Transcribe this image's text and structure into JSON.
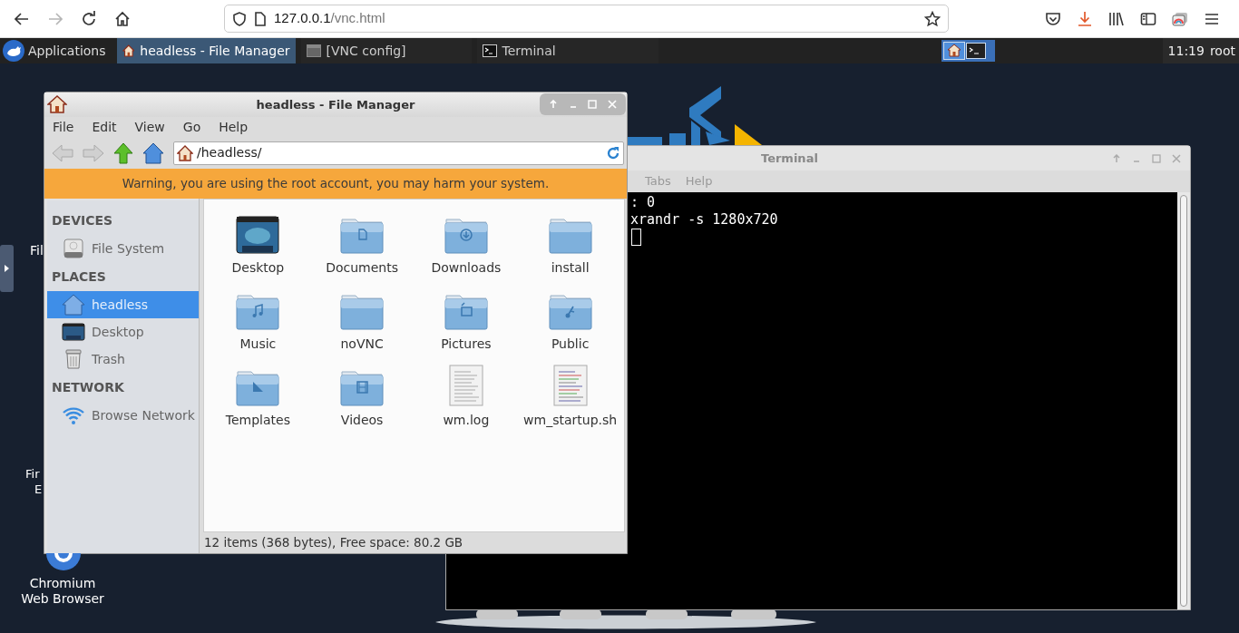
{
  "browser": {
    "forward_disabled": true,
    "url_host": "127.0.0.1",
    "url_path": "/vnc.html"
  },
  "panel": {
    "apps_label": "Applications",
    "tasks": [
      {
        "label": "headless - File Manager",
        "kind": "home",
        "selected": true
      },
      {
        "label": "[VNC config]",
        "kind": "window",
        "selected": false
      },
      {
        "label": "Terminal",
        "kind": "terminal",
        "selected": false
      }
    ],
    "clock": "11:19",
    "user": "root"
  },
  "desktop_icons": [
    {
      "lines": [
        "Fil"
      ]
    },
    {
      "lines": [
        "Fir",
        "E"
      ]
    },
    {
      "lines": [
        "Chromium",
        "Web Browser"
      ]
    }
  ],
  "file_manager": {
    "title": "headless - File Manager",
    "menu": [
      "File",
      "Edit",
      "View",
      "Go",
      "Help"
    ],
    "back_disabled": true,
    "forward_disabled": true,
    "location": "/headless/",
    "warning": "Warning, you are using the root account, you may harm your system.",
    "sidebar": [
      {
        "heading": "DEVICES",
        "items": [
          {
            "label": "File System",
            "kind": "drive",
            "selected": false
          }
        ]
      },
      {
        "heading": "PLACES",
        "items": [
          {
            "label": "headless",
            "kind": "home",
            "selected": true
          },
          {
            "label": "Desktop",
            "kind": "desktop",
            "selected": false
          },
          {
            "label": "Trash",
            "kind": "trash",
            "selected": false
          }
        ]
      },
      {
        "heading": "NETWORK",
        "items": [
          {
            "label": "Browse Network",
            "kind": "network",
            "selected": false
          }
        ]
      }
    ],
    "files": [
      {
        "label": "Desktop",
        "kind": "desktop"
      },
      {
        "label": "Documents",
        "kind": "documents"
      },
      {
        "label": "Downloads",
        "kind": "downloads"
      },
      {
        "label": "install",
        "kind": "folder"
      },
      {
        "label": "Music",
        "kind": "music"
      },
      {
        "label": "noVNC",
        "kind": "folder"
      },
      {
        "label": "Pictures",
        "kind": "pictures"
      },
      {
        "label": "Public",
        "kind": "public"
      },
      {
        "label": "Templates",
        "kind": "templates"
      },
      {
        "label": "Videos",
        "kind": "videos"
      },
      {
        "label": "wm.log",
        "kind": "text"
      },
      {
        "label": "wm_startup.sh",
        "kind": "script"
      }
    ],
    "status": "12 items (368 bytes), Free space: 80.2 GB"
  },
  "terminal": {
    "title": "Terminal",
    "menu": [
      "Tabs",
      "Help"
    ],
    "lines": [
      ": 0",
      "xrandr -s 1280x720"
    ]
  }
}
